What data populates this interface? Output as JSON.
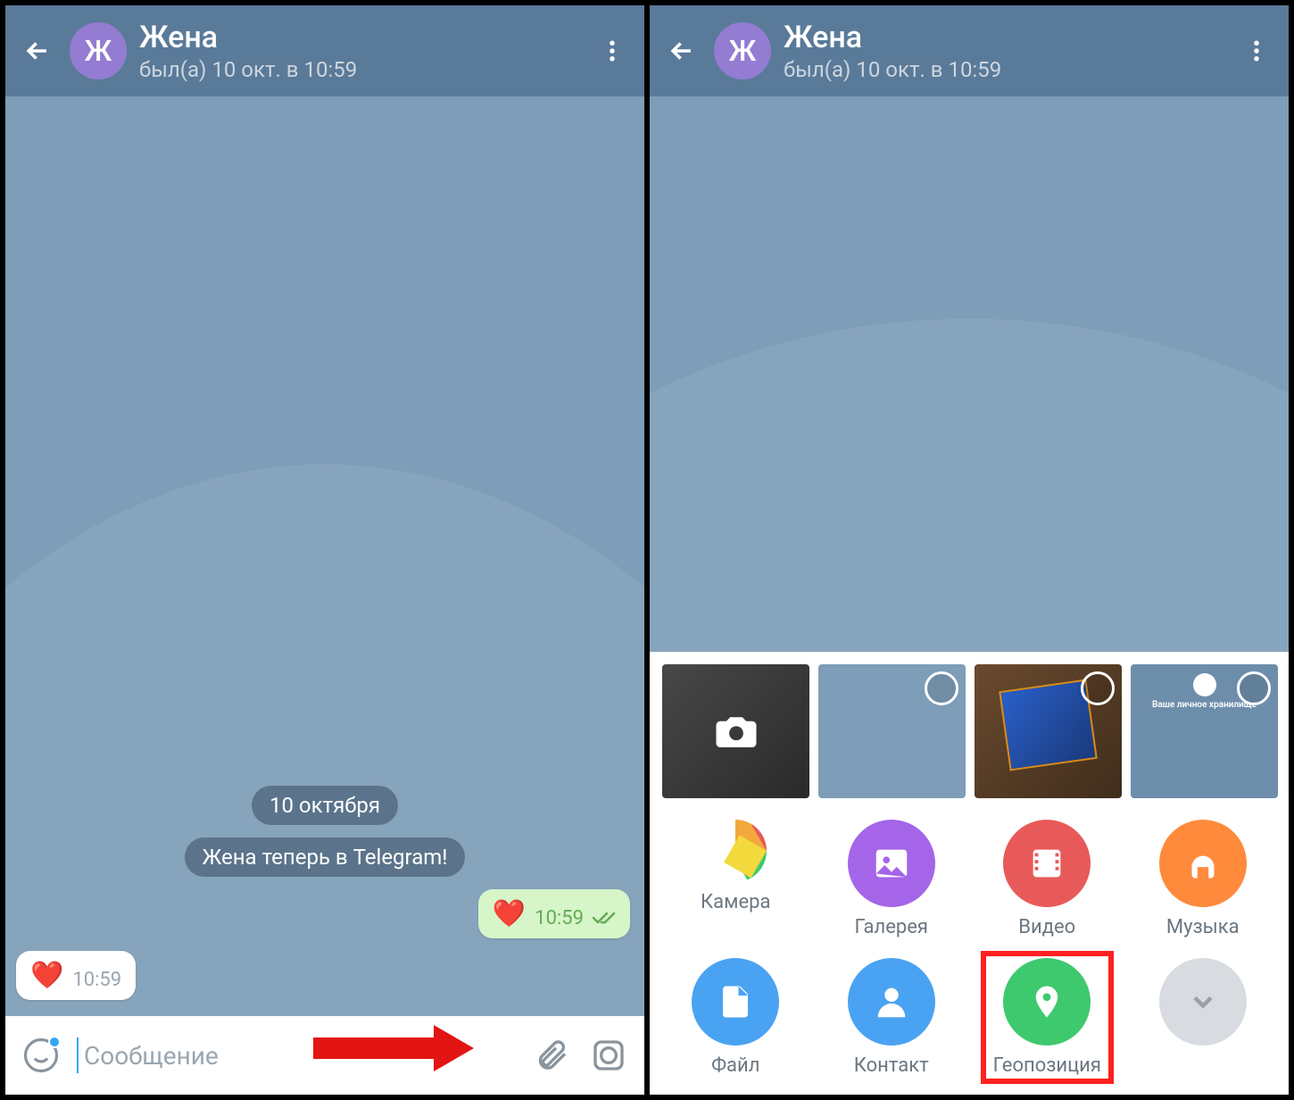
{
  "left": {
    "header": {
      "name": "Жена",
      "status": "был(а) 10 окт. в 10:59",
      "avatar": "Ж"
    },
    "chat": {
      "date": "10 октября",
      "info": "Жена теперь в Telegram!",
      "out": {
        "emoji": "❤️",
        "time": "10:59"
      },
      "in": {
        "emoji": "❤️",
        "time": "10:59"
      }
    },
    "input": {
      "placeholder": "Сообщение"
    }
  },
  "right": {
    "header": {
      "name": "Жена",
      "status": "был(а) 10 окт. в 10:59",
      "avatar": "Ж"
    },
    "thumb4": {
      "title": "Ваше личное хранилище"
    },
    "attach": {
      "camera": "Камера",
      "gallery": "Галерея",
      "video": "Видео",
      "music": "Музыка",
      "file": "Файл",
      "contact": "Контакт",
      "location": "Геопозиция"
    }
  }
}
